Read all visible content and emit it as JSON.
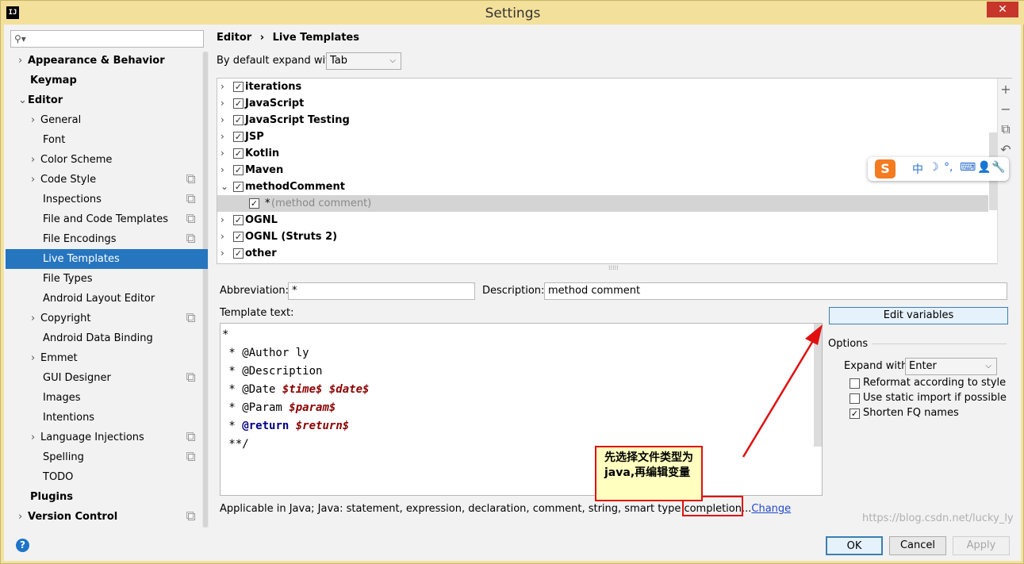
{
  "window": {
    "title": "Settings",
    "app_icon_text": "IJ",
    "close_glyph": "✕"
  },
  "sidebar": {
    "search_placeholder": "",
    "items": [
      {
        "label": "Appearance & Behavior",
        "arrow": "›",
        "bold": true
      },
      {
        "label": "Keymap",
        "bold": true
      },
      {
        "label": "Editor",
        "arrow": "⌄",
        "bold": true
      },
      {
        "label": "General",
        "arrow": "›"
      },
      {
        "label": "Font"
      },
      {
        "label": "Color Scheme",
        "arrow": "›"
      },
      {
        "label": "Code Style",
        "arrow": "›",
        "copy": true
      },
      {
        "label": "Inspections",
        "copy": true
      },
      {
        "label": "File and Code Templates",
        "copy": true
      },
      {
        "label": "File Encodings",
        "copy": true
      },
      {
        "label": "Live Templates",
        "selected": true
      },
      {
        "label": "File Types"
      },
      {
        "label": "Android Layout Editor"
      },
      {
        "label": "Copyright",
        "arrow": "›",
        "copy": true
      },
      {
        "label": "Android Data Binding"
      },
      {
        "label": "Emmet",
        "arrow": "›"
      },
      {
        "label": "GUI Designer",
        "copy": true
      },
      {
        "label": "Images"
      },
      {
        "label": "Intentions"
      },
      {
        "label": "Language Injections",
        "arrow": "›",
        "copy": true
      },
      {
        "label": "Spelling",
        "copy": true
      },
      {
        "label": "TODO"
      },
      {
        "label": "Plugins",
        "bold": true
      },
      {
        "label": "Version Control",
        "arrow": "›",
        "bold": true,
        "copy": true
      }
    ]
  },
  "breadcrumb": {
    "parent": "Editor",
    "separator": "›",
    "current": "Live Templates"
  },
  "expand_default": {
    "label": "By default expand with",
    "value": "Tab"
  },
  "template_groups": [
    {
      "label": "iterations",
      "checked": true,
      "arrow": "›"
    },
    {
      "label": "JavaScript",
      "checked": true,
      "arrow": "›"
    },
    {
      "label": "JavaScript Testing",
      "checked": true,
      "arrow": "›"
    },
    {
      "label": "JSP",
      "checked": true,
      "arrow": "›"
    },
    {
      "label": "Kotlin",
      "checked": true,
      "arrow": "›"
    },
    {
      "label": "Maven",
      "checked": true,
      "arrow": "›"
    },
    {
      "label": "methodComment",
      "checked": true,
      "arrow": "⌄"
    },
    {
      "label": "*",
      "desc": "(method comment)",
      "checked": true,
      "child": true,
      "selected": true
    },
    {
      "label": "OGNL",
      "checked": true,
      "arrow": "›"
    },
    {
      "label": "OGNL (Struts 2)",
      "checked": true,
      "arrow": "›"
    },
    {
      "label": "other",
      "checked": true,
      "arrow": "›"
    }
  ],
  "side_tools": [
    "+",
    "−",
    "⧉",
    "↶"
  ],
  "abbreviation": {
    "label": "Abbreviation:",
    "value": "*"
  },
  "description": {
    "label": "Description:",
    "value": "method comment"
  },
  "template_text": {
    "label": "Template text:",
    "lines": [
      "*",
      " * @Author ly",
      " * @Description",
      " * @Date ",
      " * @Param ",
      " * ",
      " **/"
    ],
    "date_vars": [
      "$time$",
      "$date$"
    ],
    "param_var": "$param$",
    "return_kw": "@return",
    "return_var": "$return$"
  },
  "edit_variables_button": "Edit variables",
  "options": {
    "label": "Options",
    "expand_with": {
      "label": "Expand with",
      "value": "Enter"
    },
    "reformat": {
      "label": "Reformat according to style",
      "checked": false
    },
    "static_import": {
      "label": "Use static import if possible",
      "checked": false
    },
    "shorten_fq": {
      "label": "Shorten FQ names",
      "checked": true
    }
  },
  "applicable": {
    "text": "Applicable in Java; Java: statement, expression, declaration, comment, string, smart type completion...",
    "link": "Change"
  },
  "callout": {
    "text": "先选择文件类型为java,再编辑变量"
  },
  "ime_bar": {
    "logo": "S",
    "items": [
      "中",
      "☽",
      "°,",
      "⌨",
      "👤",
      "🔧"
    ]
  },
  "buttons": {
    "ok": "OK",
    "cancel": "Cancel",
    "apply": "Apply",
    "help": "?"
  },
  "watermark": "https://blog.csdn.net/lucky_ly",
  "colors": {
    "selection": "#2675bf",
    "accent": "#3c7fb1",
    "annotation_red": "#e01010"
  }
}
